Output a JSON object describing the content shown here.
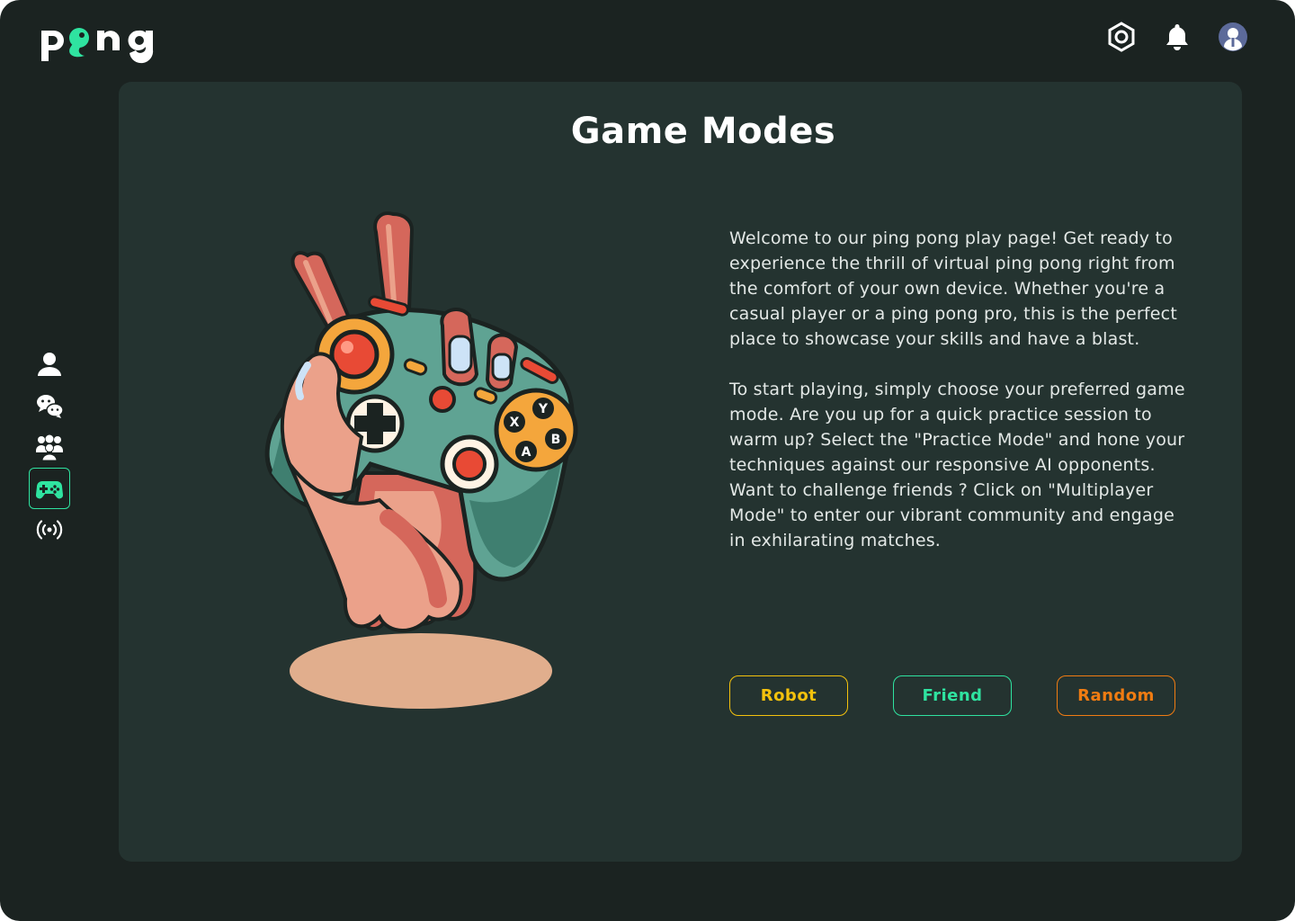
{
  "app": {
    "logo_text": "pong",
    "accent_color": "#2fe3a0"
  },
  "header": {
    "icons": [
      "settings-icon",
      "bell-icon",
      "avatar"
    ]
  },
  "sidebar": {
    "items": [
      {
        "icon": "user-icon",
        "active": false
      },
      {
        "icon": "chat-icon",
        "active": false
      },
      {
        "icon": "friends-icon",
        "active": false
      },
      {
        "icon": "gamepad-icon",
        "active": true
      },
      {
        "icon": "broadcast-icon",
        "active": false
      }
    ]
  },
  "main": {
    "title": "Game Modes",
    "paragraph_1": "Welcome to our ping pong play page! Get ready to experience the thrill of virtual ping pong right from the comfort of your own device. Whether you're a casual player or a ping pong pro, this is the perfect place to showcase your skills and have a blast.",
    "paragraph_2": "To start playing, simply choose your preferred game mode. Are you up for a quick practice session to warm up? Select the \"Practice Mode\" and hone your techniques against our responsive AI opponents. Want to challenge friends ? Click on \"Multiplayer Mode\" to enter our vibrant community and engage in exhilarating matches.",
    "modes": [
      {
        "label": "Robot",
        "color": "#f4c20d"
      },
      {
        "label": "Friend",
        "color": "#2fe3a0"
      },
      {
        "label": "Random",
        "color": "#f07c12"
      }
    ]
  }
}
